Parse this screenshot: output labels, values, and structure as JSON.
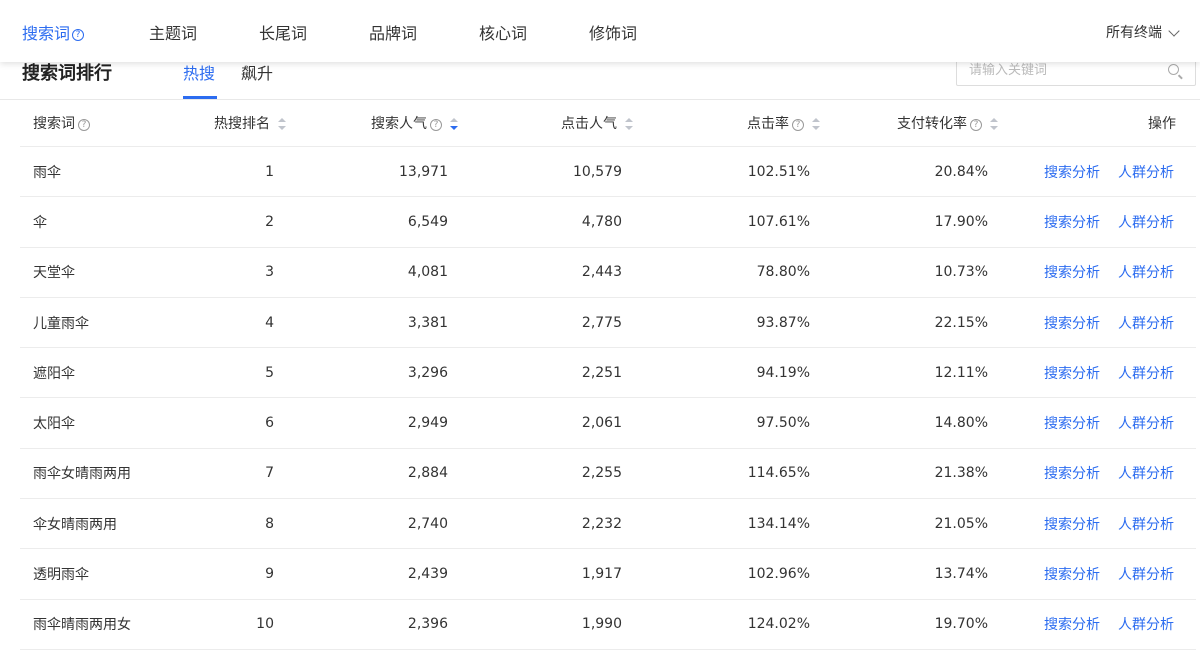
{
  "nav": {
    "tabs": [
      {
        "label": "搜索词",
        "active": true
      },
      {
        "label": "主题词"
      },
      {
        "label": "长尾词"
      },
      {
        "label": "品牌词"
      },
      {
        "label": "核心词"
      },
      {
        "label": "修饰词"
      }
    ],
    "terminal": "所有终端"
  },
  "sub": {
    "title": "搜索词排行",
    "tabs": [
      {
        "label": "热搜",
        "active": true
      },
      {
        "label": "飙升"
      }
    ],
    "search_placeholder": "请输入关键词"
  },
  "table": {
    "headers": {
      "keyword": "搜索词",
      "rank": "热搜排名",
      "popularity": "搜索人气",
      "clicks": "点击人气",
      "ctr": "点击率",
      "conversion": "支付转化率",
      "ops": "操作"
    },
    "rows": [
      {
        "keyword": "雨伞",
        "rank": "1",
        "popularity": "13,971",
        "clicks": "10,579",
        "ctr": "102.51%",
        "conversion": "20.84%",
        "op1": "搜索分析",
        "op2": "人群分析"
      },
      {
        "keyword": "伞",
        "rank": "2",
        "popularity": "6,549",
        "clicks": "4,780",
        "ctr": "107.61%",
        "conversion": "17.90%",
        "op1": "搜索分析",
        "op2": "人群分析"
      },
      {
        "keyword": "天堂伞",
        "rank": "3",
        "popularity": "4,081",
        "clicks": "2,443",
        "ctr": "78.80%",
        "conversion": "10.73%",
        "op1": "搜索分析",
        "op2": "人群分析"
      },
      {
        "keyword": "儿童雨伞",
        "rank": "4",
        "popularity": "3,381",
        "clicks": "2,775",
        "ctr": "93.87%",
        "conversion": "22.15%",
        "op1": "搜索分析",
        "op2": "人群分析"
      },
      {
        "keyword": "遮阳伞",
        "rank": "5",
        "popularity": "3,296",
        "clicks": "2,251",
        "ctr": "94.19%",
        "conversion": "12.11%",
        "op1": "搜索分析",
        "op2": "人群分析"
      },
      {
        "keyword": "太阳伞",
        "rank": "6",
        "popularity": "2,949",
        "clicks": "2,061",
        "ctr": "97.50%",
        "conversion": "14.80%",
        "op1": "搜索分析",
        "op2": "人群分析"
      },
      {
        "keyword": "雨伞女晴雨两用",
        "rank": "7",
        "popularity": "2,884",
        "clicks": "2,255",
        "ctr": "114.65%",
        "conversion": "21.38%",
        "op1": "搜索分析",
        "op2": "人群分析"
      },
      {
        "keyword": "伞女晴雨两用",
        "rank": "8",
        "popularity": "2,740",
        "clicks": "2,232",
        "ctr": "134.14%",
        "conversion": "21.05%",
        "op1": "搜索分析",
        "op2": "人群分析"
      },
      {
        "keyword": "透明雨伞",
        "rank": "9",
        "popularity": "2,439",
        "clicks": "1,917",
        "ctr": "102.96%",
        "conversion": "13.74%",
        "op1": "搜索分析",
        "op2": "人群分析"
      },
      {
        "keyword": "雨伞晴雨两用女",
        "rank": "10",
        "popularity": "2,396",
        "clicks": "1,990",
        "ctr": "124.02%",
        "conversion": "19.70%",
        "op1": "搜索分析",
        "op2": "人群分析"
      }
    ]
  }
}
